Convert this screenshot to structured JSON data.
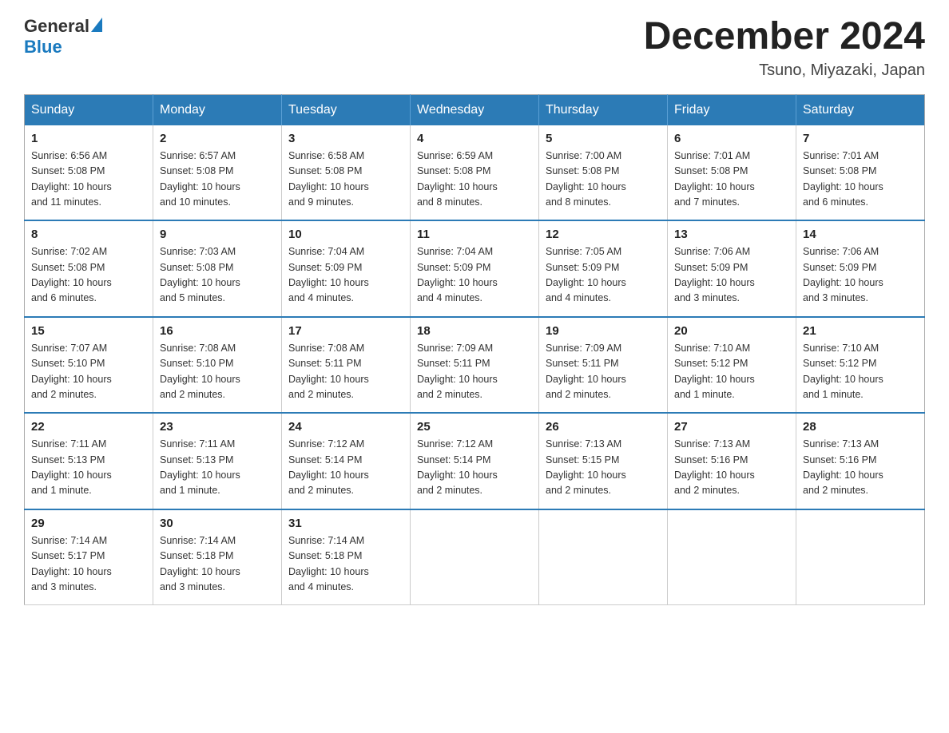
{
  "logo": {
    "general": "General",
    "blue": "Blue"
  },
  "title": "December 2024",
  "location": "Tsuno, Miyazaki, Japan",
  "headers": [
    "Sunday",
    "Monday",
    "Tuesday",
    "Wednesday",
    "Thursday",
    "Friday",
    "Saturday"
  ],
  "weeks": [
    [
      {
        "day": "1",
        "sunrise": "6:56 AM",
        "sunset": "5:08 PM",
        "daylight": "10 hours and 11 minutes."
      },
      {
        "day": "2",
        "sunrise": "6:57 AM",
        "sunset": "5:08 PM",
        "daylight": "10 hours and 10 minutes."
      },
      {
        "day": "3",
        "sunrise": "6:58 AM",
        "sunset": "5:08 PM",
        "daylight": "10 hours and 9 minutes."
      },
      {
        "day": "4",
        "sunrise": "6:59 AM",
        "sunset": "5:08 PM",
        "daylight": "10 hours and 8 minutes."
      },
      {
        "day": "5",
        "sunrise": "7:00 AM",
        "sunset": "5:08 PM",
        "daylight": "10 hours and 8 minutes."
      },
      {
        "day": "6",
        "sunrise": "7:01 AM",
        "sunset": "5:08 PM",
        "daylight": "10 hours and 7 minutes."
      },
      {
        "day": "7",
        "sunrise": "7:01 AM",
        "sunset": "5:08 PM",
        "daylight": "10 hours and 6 minutes."
      }
    ],
    [
      {
        "day": "8",
        "sunrise": "7:02 AM",
        "sunset": "5:08 PM",
        "daylight": "10 hours and 6 minutes."
      },
      {
        "day": "9",
        "sunrise": "7:03 AM",
        "sunset": "5:08 PM",
        "daylight": "10 hours and 5 minutes."
      },
      {
        "day": "10",
        "sunrise": "7:04 AM",
        "sunset": "5:09 PM",
        "daylight": "10 hours and 4 minutes."
      },
      {
        "day": "11",
        "sunrise": "7:04 AM",
        "sunset": "5:09 PM",
        "daylight": "10 hours and 4 minutes."
      },
      {
        "day": "12",
        "sunrise": "7:05 AM",
        "sunset": "5:09 PM",
        "daylight": "10 hours and 4 minutes."
      },
      {
        "day": "13",
        "sunrise": "7:06 AM",
        "sunset": "5:09 PM",
        "daylight": "10 hours and 3 minutes."
      },
      {
        "day": "14",
        "sunrise": "7:06 AM",
        "sunset": "5:09 PM",
        "daylight": "10 hours and 3 minutes."
      }
    ],
    [
      {
        "day": "15",
        "sunrise": "7:07 AM",
        "sunset": "5:10 PM",
        "daylight": "10 hours and 2 minutes."
      },
      {
        "day": "16",
        "sunrise": "7:08 AM",
        "sunset": "5:10 PM",
        "daylight": "10 hours and 2 minutes."
      },
      {
        "day": "17",
        "sunrise": "7:08 AM",
        "sunset": "5:11 PM",
        "daylight": "10 hours and 2 minutes."
      },
      {
        "day": "18",
        "sunrise": "7:09 AM",
        "sunset": "5:11 PM",
        "daylight": "10 hours and 2 minutes."
      },
      {
        "day": "19",
        "sunrise": "7:09 AM",
        "sunset": "5:11 PM",
        "daylight": "10 hours and 2 minutes."
      },
      {
        "day": "20",
        "sunrise": "7:10 AM",
        "sunset": "5:12 PM",
        "daylight": "10 hours and 1 minute."
      },
      {
        "day": "21",
        "sunrise": "7:10 AM",
        "sunset": "5:12 PM",
        "daylight": "10 hours and 1 minute."
      }
    ],
    [
      {
        "day": "22",
        "sunrise": "7:11 AM",
        "sunset": "5:13 PM",
        "daylight": "10 hours and 1 minute."
      },
      {
        "day": "23",
        "sunrise": "7:11 AM",
        "sunset": "5:13 PM",
        "daylight": "10 hours and 1 minute."
      },
      {
        "day": "24",
        "sunrise": "7:12 AM",
        "sunset": "5:14 PM",
        "daylight": "10 hours and 2 minutes."
      },
      {
        "day": "25",
        "sunrise": "7:12 AM",
        "sunset": "5:14 PM",
        "daylight": "10 hours and 2 minutes."
      },
      {
        "day": "26",
        "sunrise": "7:13 AM",
        "sunset": "5:15 PM",
        "daylight": "10 hours and 2 minutes."
      },
      {
        "day": "27",
        "sunrise": "7:13 AM",
        "sunset": "5:16 PM",
        "daylight": "10 hours and 2 minutes."
      },
      {
        "day": "28",
        "sunrise": "7:13 AM",
        "sunset": "5:16 PM",
        "daylight": "10 hours and 2 minutes."
      }
    ],
    [
      {
        "day": "29",
        "sunrise": "7:14 AM",
        "sunset": "5:17 PM",
        "daylight": "10 hours and 3 minutes."
      },
      {
        "day": "30",
        "sunrise": "7:14 AM",
        "sunset": "5:18 PM",
        "daylight": "10 hours and 3 minutes."
      },
      {
        "day": "31",
        "sunrise": "7:14 AM",
        "sunset": "5:18 PM",
        "daylight": "10 hours and 4 minutes."
      },
      null,
      null,
      null,
      null
    ]
  ],
  "labels": {
    "sunrise": "Sunrise:",
    "sunset": "Sunset:",
    "daylight": "Daylight:"
  }
}
